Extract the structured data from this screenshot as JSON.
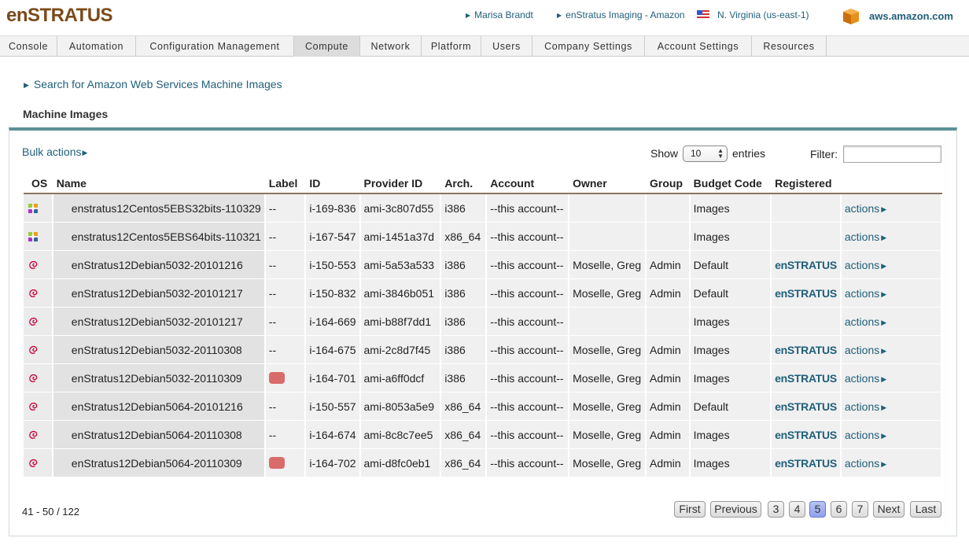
{
  "header": {
    "logo": "enSTRATUS",
    "user": "Marisa Brandt",
    "account": "enStratus Imaging - Amazon",
    "region": "N. Virginia (us-east-1)",
    "provider": "aws.amazon.com"
  },
  "nav": [
    {
      "label": "Console"
    },
    {
      "label": "Automation"
    },
    {
      "label": "Configuration Management"
    },
    {
      "label": "Compute",
      "active": true
    },
    {
      "label": "Network"
    },
    {
      "label": "Platform"
    },
    {
      "label": "Users"
    },
    {
      "label": "Company Settings"
    },
    {
      "label": "Account Settings"
    },
    {
      "label": "Resources"
    }
  ],
  "search_link": "Search for Amazon Web Services Machine Images",
  "section_title": "Machine Images",
  "toolbar": {
    "bulk_actions": "Bulk actions",
    "show_label": "Show",
    "show_value": "10",
    "entries_label": "entries",
    "filter_label": "Filter:",
    "filter_value": ""
  },
  "columns": [
    "OS",
    "Name",
    "Label",
    "ID",
    "Provider ID",
    "Arch.",
    "Account",
    "Owner",
    "Group",
    "Budget Code",
    "Registered",
    ""
  ],
  "rows": [
    {
      "os": "centos",
      "name": "enstratus12Centos5EBS32bits-110329",
      "label": "--",
      "id": "i-169-836",
      "provider_id": "ami-3c807d55",
      "arch": "i386",
      "account": "--this account--",
      "owner": "",
      "group": "",
      "budget": "Images",
      "registered": "",
      "actions": "actions"
    },
    {
      "os": "centos",
      "name": "enstratus12Centos5EBS64bits-110321",
      "label": "--",
      "id": "i-167-547",
      "provider_id": "ami-1451a37d",
      "arch": "x86_64",
      "account": "--this account--",
      "owner": "",
      "group": "",
      "budget": "Images",
      "registered": "",
      "actions": "actions"
    },
    {
      "os": "debian",
      "name": "enStratus12Debian5032-20101216",
      "label": "--",
      "id": "i-150-553",
      "provider_id": "ami-5a53a533",
      "arch": "i386",
      "account": "--this account--",
      "owner": "Moselle, Greg",
      "group": "Admin",
      "budget": "Default",
      "registered": "enSTRATUS",
      "actions": "actions"
    },
    {
      "os": "debian",
      "name": "enStratus12Debian5032-20101217",
      "label": "--",
      "id": "i-150-832",
      "provider_id": "ami-3846b051",
      "arch": "i386",
      "account": "--this account--",
      "owner": "Moselle, Greg",
      "group": "Admin",
      "budget": "Default",
      "registered": "enSTRATUS",
      "actions": "actions"
    },
    {
      "os": "debian",
      "name": "enStratus12Debian5032-20101217",
      "label": "--",
      "id": "i-164-669",
      "provider_id": "ami-b88f7dd1",
      "arch": "i386",
      "account": "--this account--",
      "owner": "",
      "group": "",
      "budget": "Images",
      "registered": "",
      "actions": "actions"
    },
    {
      "os": "debian",
      "name": "enStratus12Debian5032-20110308",
      "label": "--",
      "id": "i-164-675",
      "provider_id": "ami-2c8d7f45",
      "arch": "i386",
      "account": "--this account--",
      "owner": "Moselle, Greg",
      "group": "Admin",
      "budget": "Images",
      "registered": "enSTRATUS",
      "actions": "actions"
    },
    {
      "os": "debian",
      "name": "enStratus12Debian5032-20110309",
      "label": "",
      "label_color": "#d96b6b",
      "id": "i-164-701",
      "provider_id": "ami-a6ff0dcf",
      "arch": "i386",
      "account": "--this account--",
      "owner": "Moselle, Greg",
      "group": "Admin",
      "budget": "Images",
      "registered": "enSTRATUS",
      "actions": "actions"
    },
    {
      "os": "debian",
      "name": "enStratus12Debian5064-20101216",
      "label": "--",
      "id": "i-150-557",
      "provider_id": "ami-8053a5e9",
      "arch": "x86_64",
      "account": "--this account--",
      "owner": "Moselle, Greg",
      "group": "Admin",
      "budget": "Default",
      "registered": "enSTRATUS",
      "actions": "actions"
    },
    {
      "os": "debian",
      "name": "enStratus12Debian5064-20110308",
      "label": "--",
      "id": "i-164-674",
      "provider_id": "ami-8c8c7ee5",
      "arch": "x86_64",
      "account": "--this account--",
      "owner": "Moselle, Greg",
      "group": "Admin",
      "budget": "Images",
      "registered": "enSTRATUS",
      "actions": "actions"
    },
    {
      "os": "debian",
      "name": "enStratus12Debian5064-20110309",
      "label": "",
      "label_color": "#d96b6b",
      "id": "i-164-702",
      "provider_id": "ami-d8fc0eb1",
      "arch": "x86_64",
      "account": "--this account--",
      "owner": "Moselle, Greg",
      "group": "Admin",
      "budget": "Images",
      "registered": "enSTRATUS",
      "actions": "actions"
    }
  ],
  "footer": {
    "count": "41 - 50 / 122",
    "pager": [
      {
        "label": "First"
      },
      {
        "label": "Previous"
      },
      {
        "label": "3"
      },
      {
        "label": "4"
      },
      {
        "label": "5",
        "current": true
      },
      {
        "label": "6"
      },
      {
        "label": "7"
      },
      {
        "label": "Next"
      },
      {
        "label": "Last"
      }
    ]
  }
}
